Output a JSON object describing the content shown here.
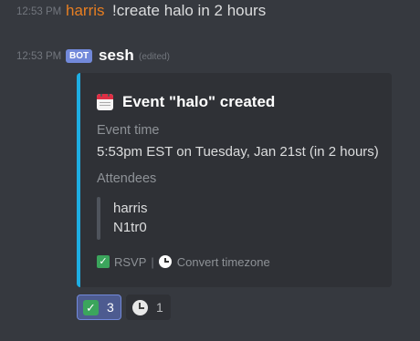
{
  "message1": {
    "timestamp": "12:53 PM",
    "author": "harris",
    "text": "!create halo in 2 hours"
  },
  "message2": {
    "timestamp": "12:53 PM",
    "bot_tag": "BOT",
    "author": "sesh",
    "edited_label": "(edited)",
    "embed": {
      "title_icon": "calendar-icon",
      "title": "Event \"halo\" created",
      "accent_color": "#1eaee3",
      "fields": {
        "event_time_label": "Event time",
        "event_time_value": "5:53pm EST on Tuesday, Jan 21st (in 2 hours)",
        "attendees_label": "Attendees",
        "attendees": [
          "harris",
          "N1tr0"
        ]
      },
      "footer": {
        "rsvp_icon": "check-icon",
        "rsvp_label": "RSVP",
        "separator": "|",
        "timezone_icon": "clock-icon",
        "timezone_label": "Convert timezone"
      }
    },
    "reactions": [
      {
        "emoji": "check-icon",
        "count": "3",
        "selected": true
      },
      {
        "emoji": "clock-icon",
        "count": "1",
        "selected": false
      }
    ]
  },
  "colors": {
    "background": "#36393f",
    "embed_background": "#2f3136",
    "harris_name": "#e67e22",
    "bot_tag": "#7289da",
    "check_green": "#3ba55c"
  }
}
